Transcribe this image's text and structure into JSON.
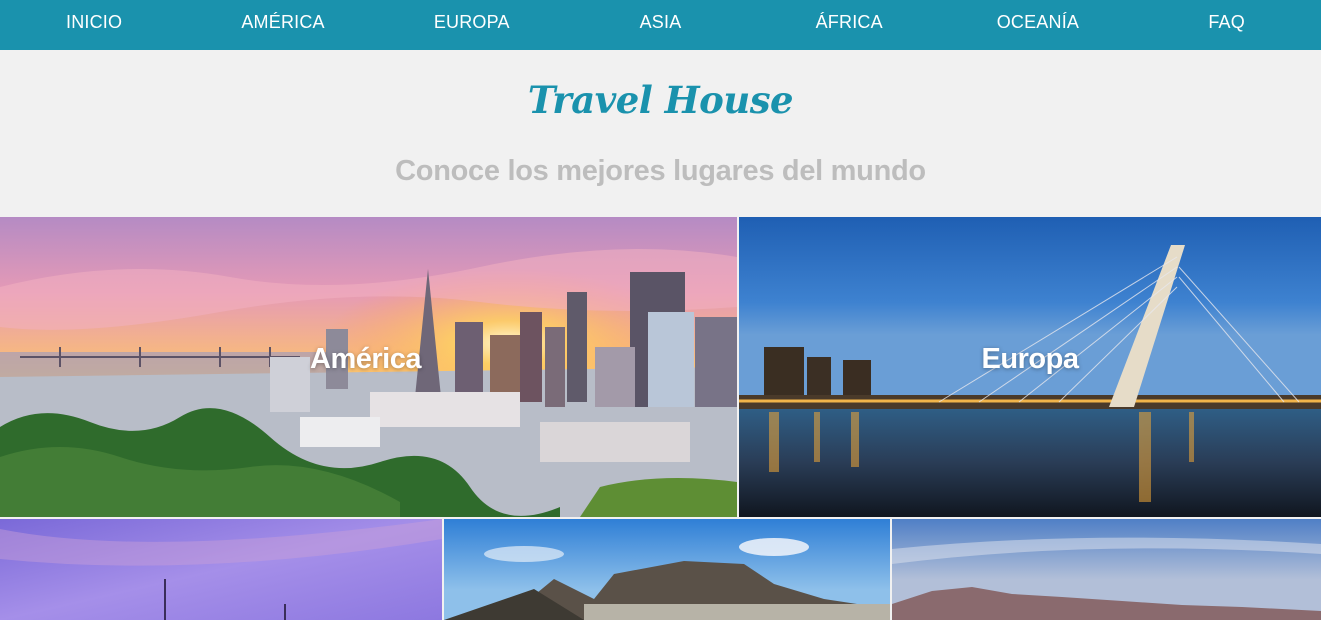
{
  "nav": {
    "items": [
      "INICIO",
      "AMÉRICA",
      "EUROPA",
      "ASIA",
      "ÁFRICA",
      "OCEANÍA",
      "FAQ"
    ]
  },
  "header": {
    "brand": "Travel House",
    "tagline": "Conoce los mejores lugares del mundo"
  },
  "destinations": [
    {
      "label": "América"
    },
    {
      "label": "Europa"
    },
    {
      "label": ""
    },
    {
      "label": ""
    },
    {
      "label": ""
    }
  ],
  "colors": {
    "accent": "#1a92ad",
    "page_background": "#f1f1f1",
    "tagline": "#bdbdbd"
  }
}
